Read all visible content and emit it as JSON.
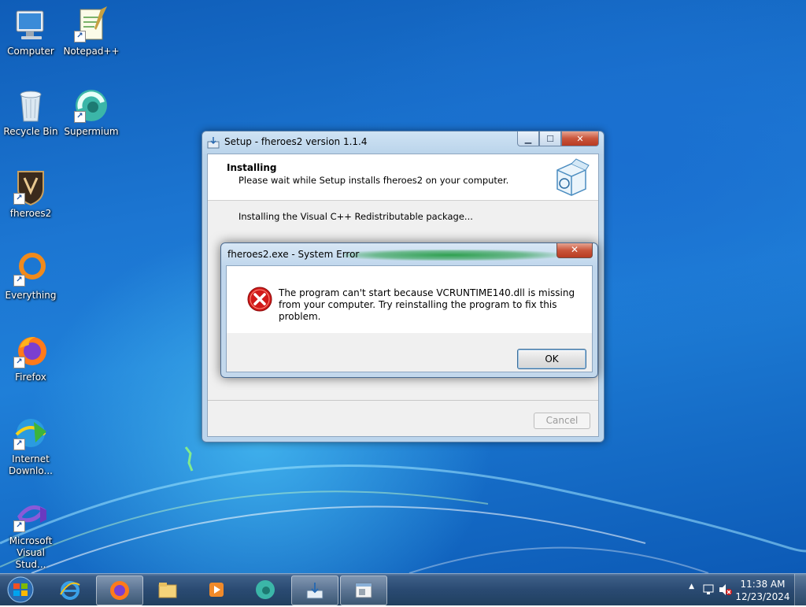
{
  "desktop_icons": [
    {
      "label": "Computer",
      "icon": "computer-icon"
    },
    {
      "label": "Notepad++",
      "icon": "notepadpp-icon"
    },
    {
      "label": "Recycle Bin",
      "icon": "recycle-bin-icon"
    },
    {
      "label": "Supermium",
      "icon": "supermium-icon"
    },
    {
      "label": "fheroes2",
      "icon": "fheroes2-icon"
    },
    {
      "label": "Everything",
      "icon": "everything-icon"
    },
    {
      "label": "Firefox",
      "icon": "firefox-icon"
    },
    {
      "label_line1": "Internet",
      "label_line2": "Downlo...",
      "icon": "internet-download-manager-icon"
    },
    {
      "label_line1": "Microsoft",
      "label_line2": "Visual Stud...",
      "icon": "visual-studio-icon"
    }
  ],
  "setup_window": {
    "title": "Setup - fheroes2 version 1.1.4",
    "header_title": "Installing",
    "header_subtitle": "Please wait while Setup installs fheroes2 on your computer.",
    "status": "Installing the Visual C++ Redistributable package...",
    "cancel_label": "Cancel",
    "minimize_glyph": "▁",
    "maximize_glyph": "☐",
    "close_glyph": "✕"
  },
  "error_dialog": {
    "title": "fheroes2.exe - System Error",
    "message": "The program can't start because VCRUNTIME140.dll is missing from your computer. Try reinstalling the program to fix this problem.",
    "ok_label": "OK",
    "close_glyph": "✕"
  },
  "taskbar": {
    "pinned": [
      "start-orb",
      "internet-explorer-icon",
      "firefox-icon",
      "file-explorer-icon",
      "media-player-icon",
      "supermium-icon",
      "setup-icon",
      "system-error-icon"
    ],
    "tray": {
      "show_hidden": "▲",
      "time": "11:38 AM",
      "date": "12/23/2024"
    }
  },
  "colors": {
    "desktop_blue": "#1c76d2",
    "taskbar": "#2a4a72",
    "close_red": "#c9553b",
    "error_red": "#d11a1a"
  }
}
